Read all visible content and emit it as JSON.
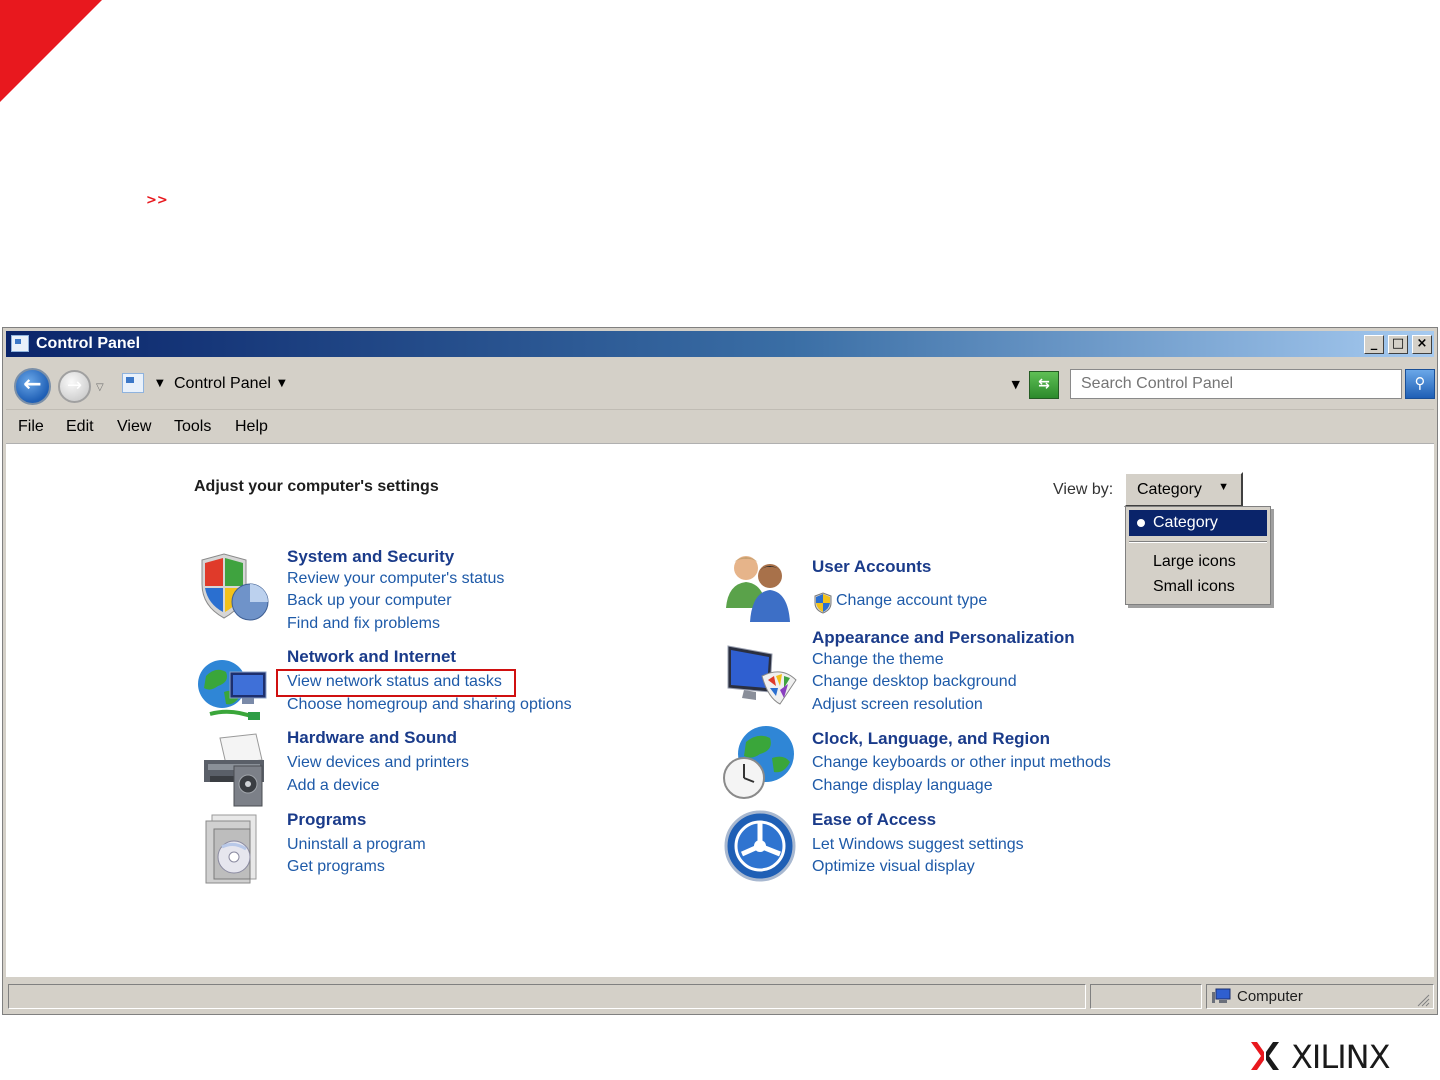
{
  "slide": {
    "bullet_marker": ">>",
    "logo_text": "XILINX"
  },
  "window": {
    "title": "Control Panel",
    "controls": {
      "minimize": "_",
      "maximize": "□",
      "close": "×"
    }
  },
  "navbar": {
    "breadcrumb": "Control Panel",
    "search_placeholder": "Search Control Panel"
  },
  "menubar": {
    "items": [
      "File",
      "Edit",
      "View",
      "Tools",
      "Help"
    ]
  },
  "content": {
    "heading": "Adjust your computer's settings",
    "view_by_label": "View by:",
    "view_by_value": "Category",
    "view_options": [
      "Category",
      "Large icons",
      "Small icons"
    ],
    "categories_left": [
      {
        "title": "System and Security",
        "icon": "shield-icon",
        "links": [
          "Review your computer's status",
          "Back up your computer",
          "Find and fix problems"
        ]
      },
      {
        "title": "Network and Internet",
        "icon": "network-globe-icon",
        "links": [
          "View network status and tasks",
          "Choose homegroup and sharing options"
        ]
      },
      {
        "title": "Hardware and Sound",
        "icon": "printer-icon",
        "links": [
          "View devices and printers",
          "Add a device"
        ]
      },
      {
        "title": "Programs",
        "icon": "programs-icon",
        "links": [
          "Uninstall a program",
          "Get programs"
        ]
      }
    ],
    "categories_right": [
      {
        "title": "User Accounts",
        "icon": "users-icon",
        "links": [
          "Change account type"
        ]
      },
      {
        "title": "Appearance and Personalization",
        "icon": "monitor-palette-icon",
        "links": [
          "Change the theme",
          "Change desktop background",
          "Adjust screen resolution"
        ]
      },
      {
        "title": "Clock, Language, and Region",
        "icon": "globe-clock-icon",
        "links": [
          "Change keyboards or other input methods",
          "Change display language"
        ]
      },
      {
        "title": "Ease of Access",
        "icon": "ease-of-access-icon",
        "links": [
          "Let Windows suggest settings",
          "Optimize visual display"
        ]
      }
    ]
  },
  "statusbar": {
    "location": "Computer"
  },
  "colors": {
    "accent_red": "#e8181e",
    "title_gradient_start": "#0a246a",
    "link_blue": "#1e5aa8",
    "highlight_red": "#d01010"
  }
}
